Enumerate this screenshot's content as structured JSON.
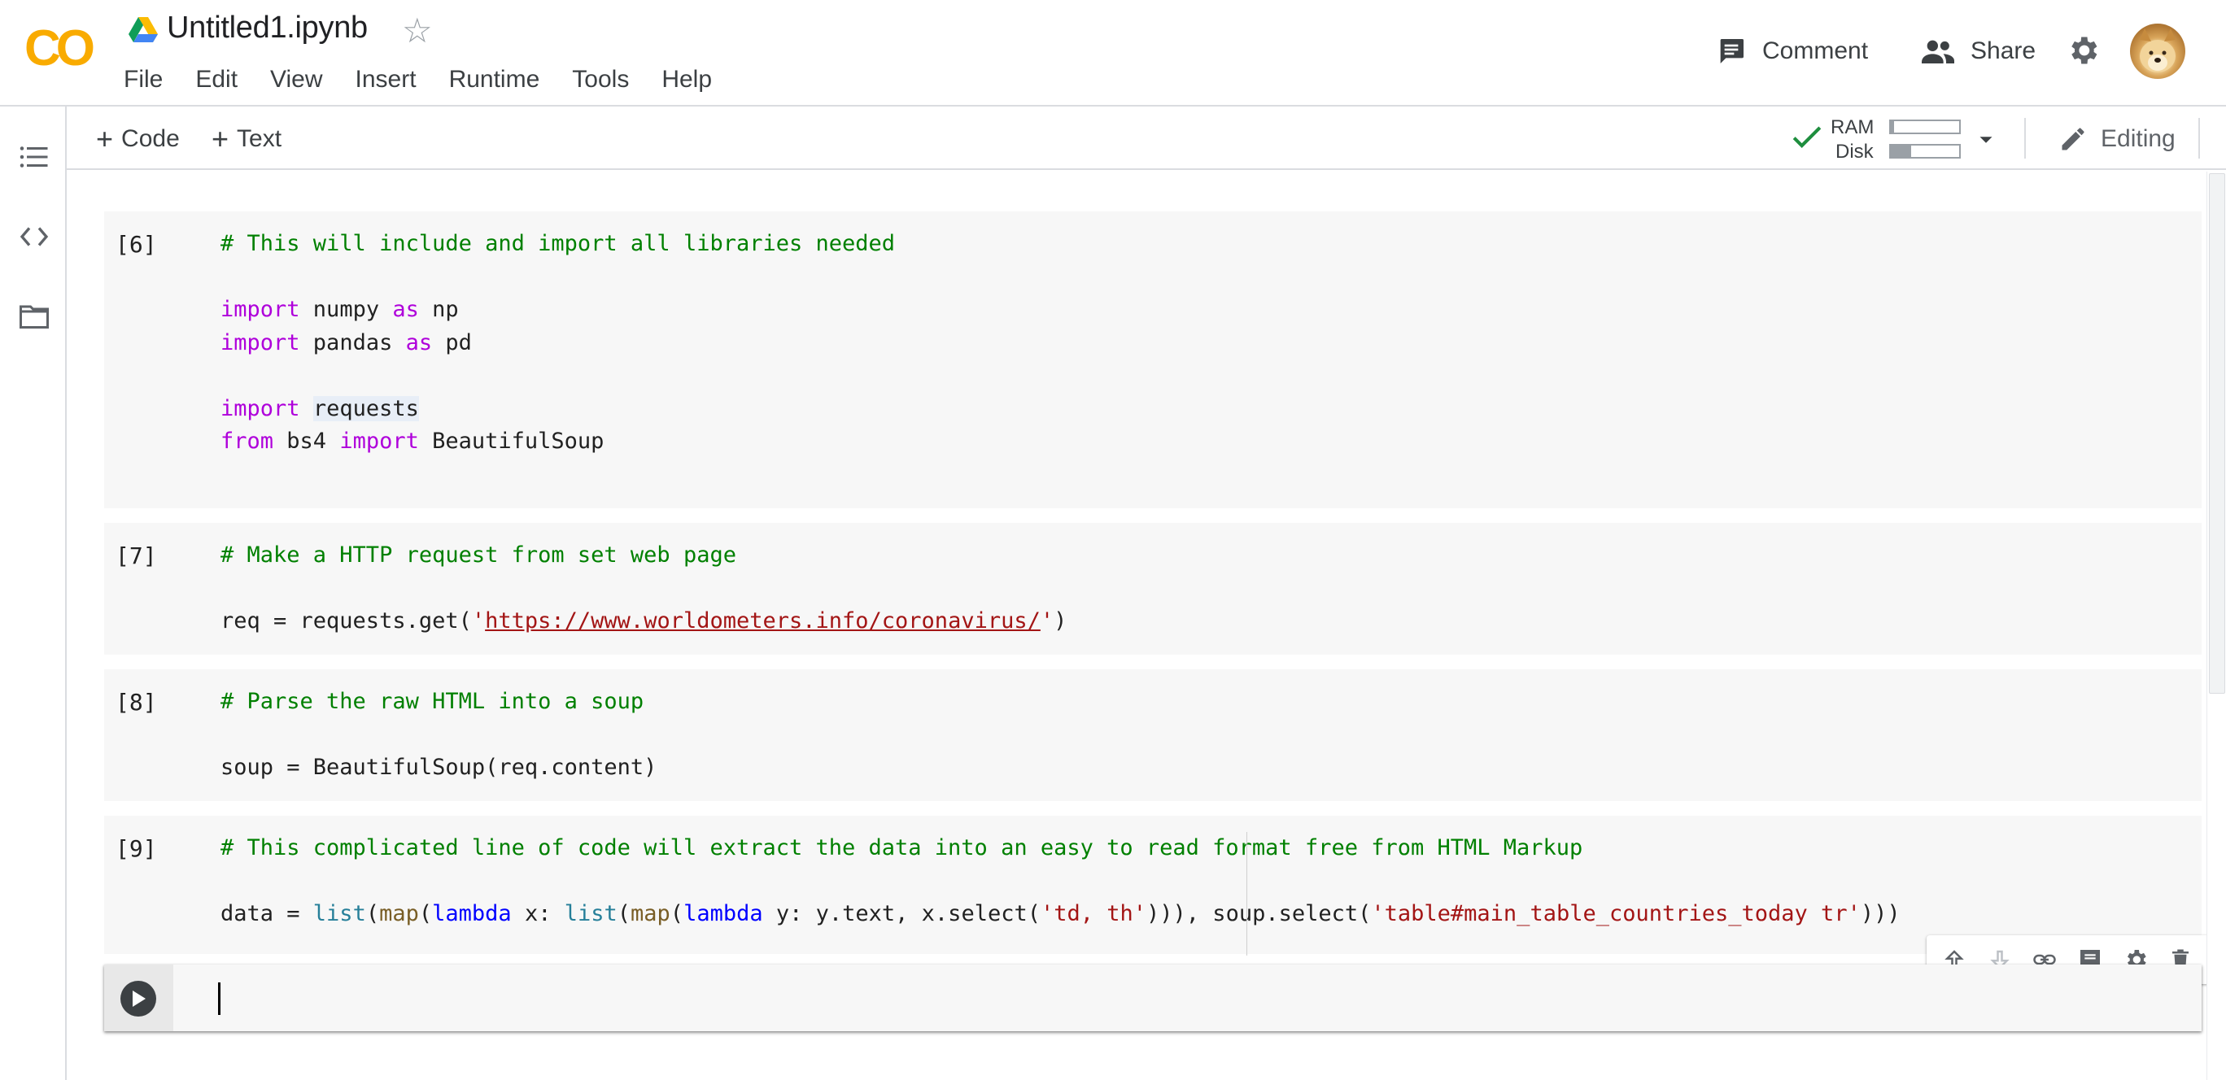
{
  "header": {
    "notebook_title": "Untitled1.ipynb",
    "logo_text": "CO",
    "menu": [
      "File",
      "Edit",
      "View",
      "Insert",
      "Runtime",
      "Tools",
      "Help"
    ],
    "comment_label": "Comment",
    "share_label": "Share"
  },
  "toolbar": {
    "add_code_label": "Code",
    "add_text_label": "Text",
    "ram_label": "RAM",
    "disk_label": "Disk",
    "ram_usage_fraction": 0.05,
    "disk_usage_fraction": 0.3,
    "editing_label": "Editing"
  },
  "cells": [
    {
      "exec_count": "[6]",
      "lines": [
        "# This will include and import all libraries needed",
        "",
        "import numpy as np",
        "import pandas as pd",
        "",
        "import requests",
        "from bs4 import BeautifulSoup"
      ]
    },
    {
      "exec_count": "[7]",
      "lines": [
        "# Make a HTTP request from set web page",
        "",
        "req = requests.get('https://www.worldometers.info/coronavirus/')"
      ]
    },
    {
      "exec_count": "[8]",
      "lines": [
        "# Parse the raw HTML into a soup",
        "",
        "soup = BeautifulSoup(req.content)"
      ]
    },
    {
      "exec_count": "[9]",
      "lines": [
        "# This complicated line of code will extract the data into an easy to read format free from HTML Markup",
        "",
        "data = list(map(lambda x: list(map(lambda y: y.text, x.select('td, th'))), soup.select('table#main_table_countries_today tr')))"
      ]
    }
  ],
  "colors": {
    "comment": "#008000",
    "keyword": "#af00db",
    "string": "#a31515",
    "builtin": "#267f99",
    "check": "#1e8e3e"
  }
}
